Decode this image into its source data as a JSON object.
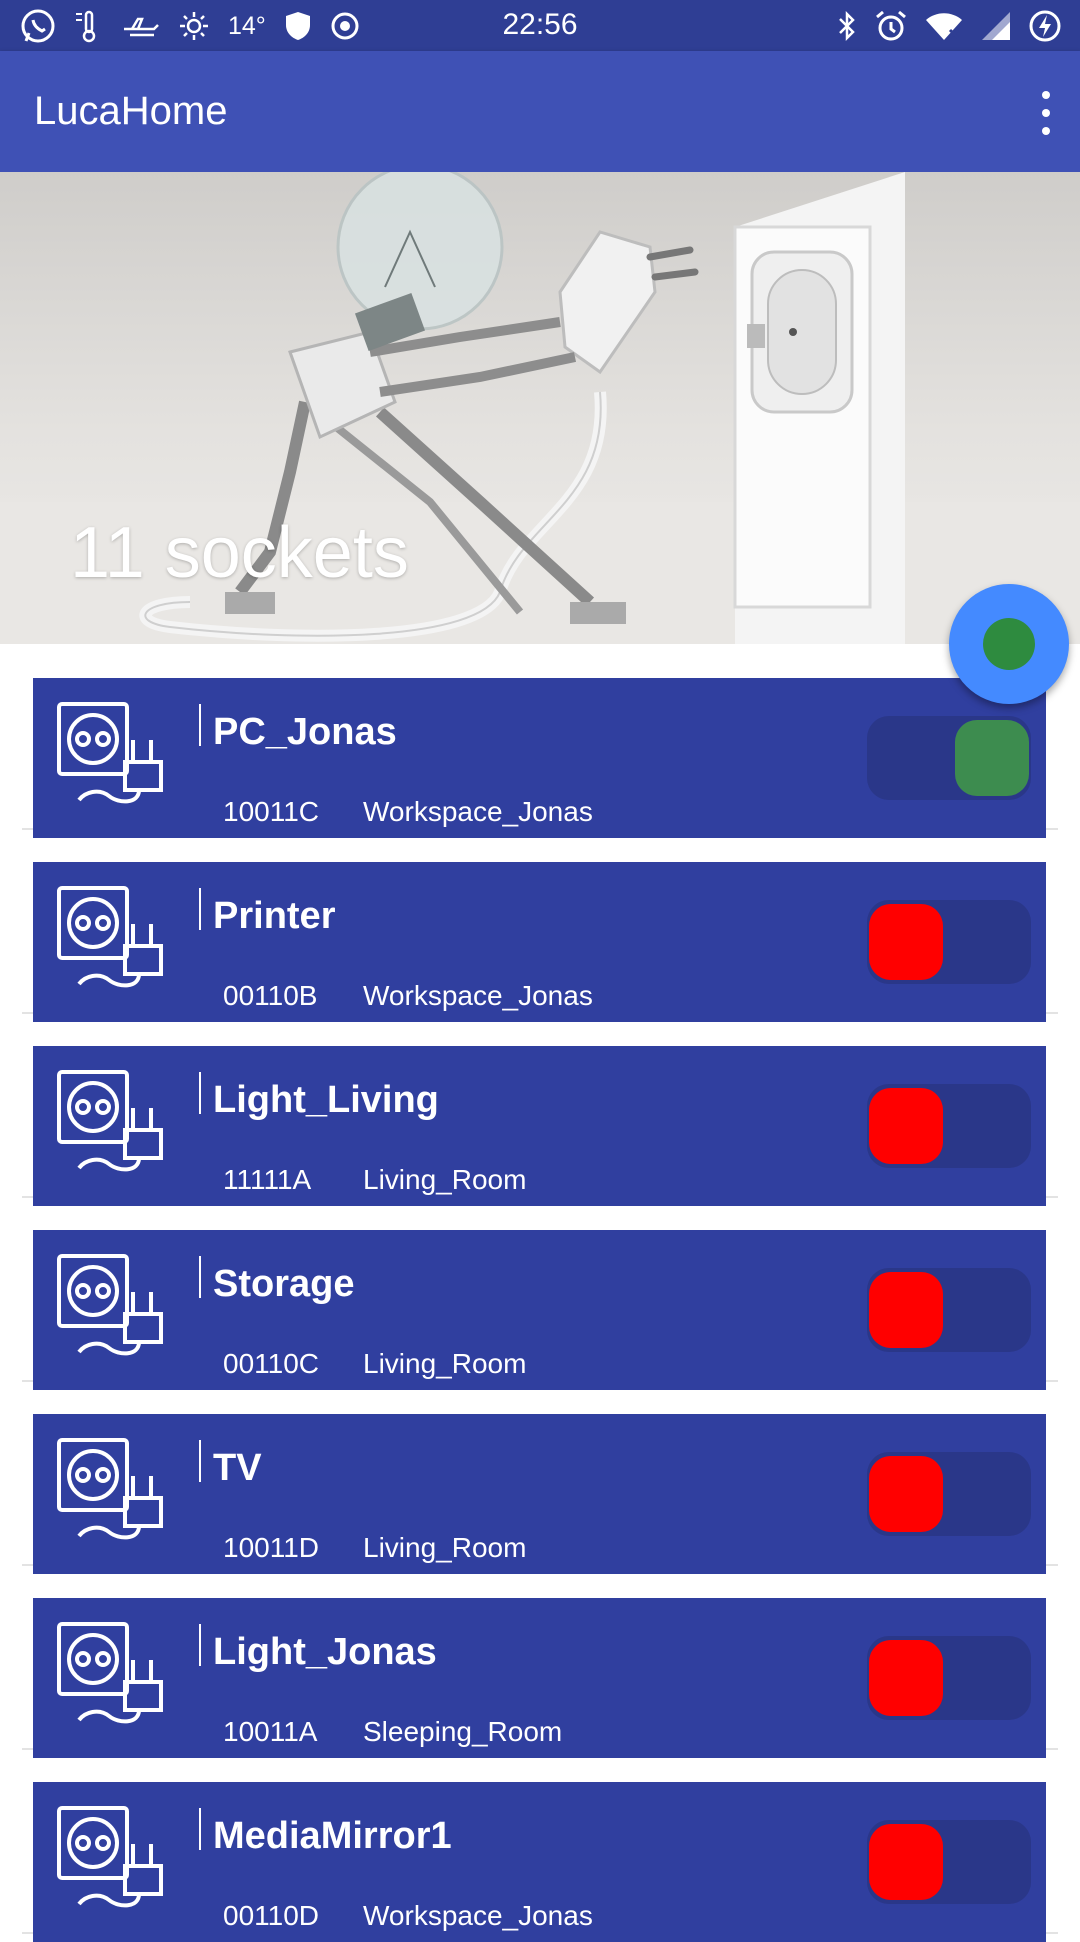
{
  "status_bar": {
    "time": "22:56",
    "temperature": "14°",
    "left_icons": [
      "whatsapp-icon",
      "temperature-icon",
      "airplane-icon",
      "brightness-icon",
      "shield-icon",
      "record-icon"
    ],
    "right_icons": [
      "bluetooth-icon",
      "alarm-icon",
      "wifi-icon",
      "signal-icon",
      "battery-charging-icon"
    ]
  },
  "app_bar": {
    "title": "LucaHome",
    "menu_icon": "more-vert-icon"
  },
  "hero": {
    "title": "11 sockets"
  },
  "fab": {
    "icon": "status-dot-icon",
    "color": "#448aff",
    "dot_color": "#2e8b3f"
  },
  "colors": {
    "primary": "#3f51b5",
    "status_bar": "#2f3e94",
    "card": "#303f9f",
    "switch_on": "#3d8c4f",
    "switch_off": "#ff0000"
  },
  "sockets": [
    {
      "name": "PC_Jonas",
      "code": "10011C",
      "area": "Workspace_Jonas",
      "state": true
    },
    {
      "name": "Printer",
      "code": "00110B",
      "area": "Workspace_Jonas",
      "state": false
    },
    {
      "name": "Light_Living",
      "code": "11111A",
      "area": "Living_Room",
      "state": false
    },
    {
      "name": "Storage",
      "code": "00110C",
      "area": "Living_Room",
      "state": false
    },
    {
      "name": "TV",
      "code": "10011D",
      "area": "Living_Room",
      "state": false
    },
    {
      "name": "Light_Jonas",
      "code": "10011A",
      "area": "Sleeping_Room",
      "state": false
    },
    {
      "name": "MediaMirror1",
      "code": "00110D",
      "area": "Workspace_Jonas",
      "state": false
    }
  ]
}
